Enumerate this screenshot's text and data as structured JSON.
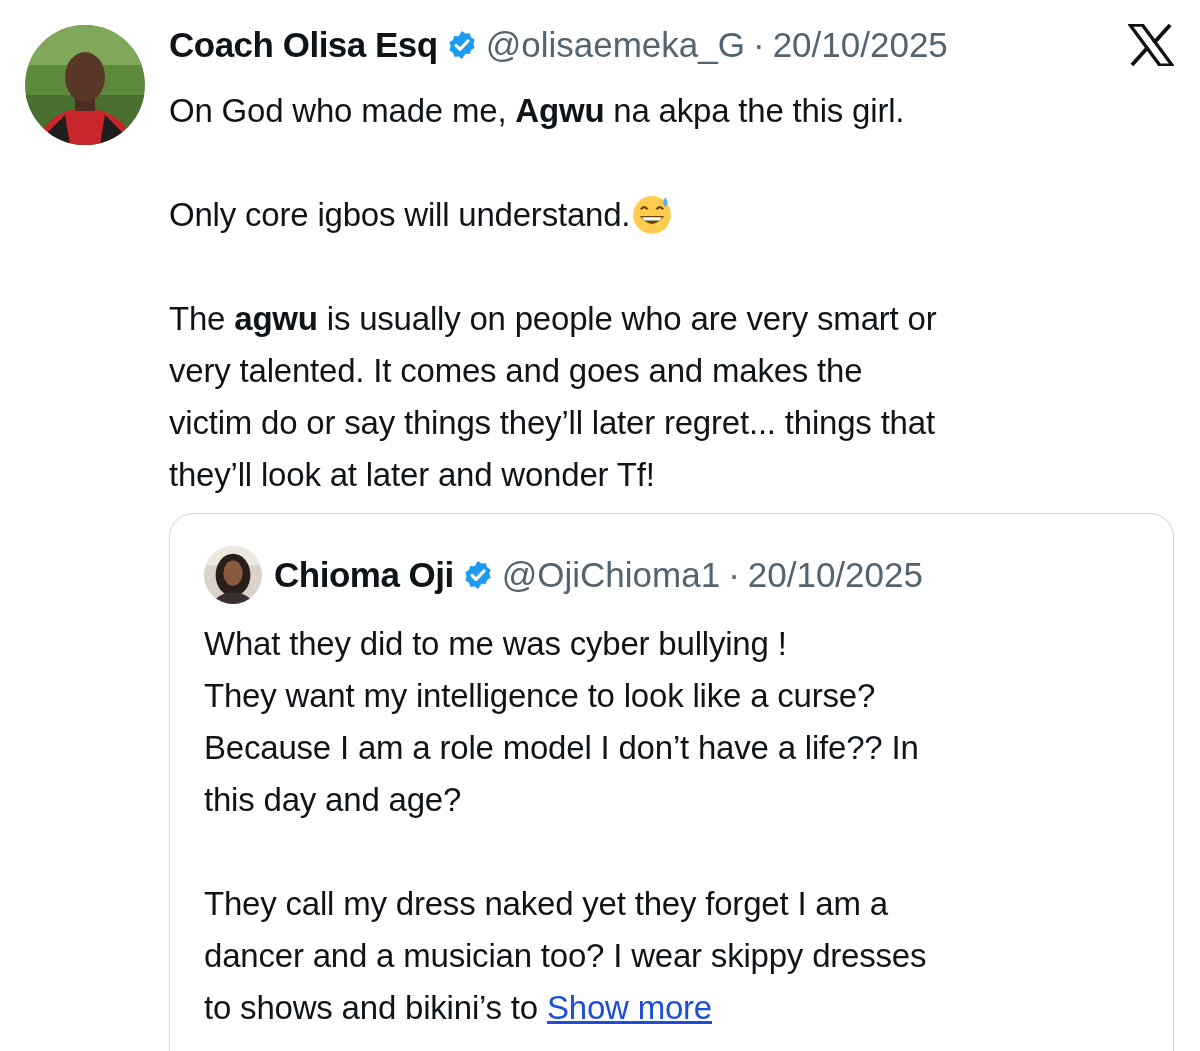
{
  "post": {
    "author": {
      "name": "Coach Olisa Esq",
      "verified": true,
      "handle": "@olisaemeka_G",
      "separator": "·",
      "date": "20/10/2025"
    },
    "paragraphs": [
      {
        "text": "On God who made me, **Agwu** na akpa the this girl.",
        "emoji": false
      },
      {
        "text": "Only core igbos will understand.",
        "emoji": true
      },
      {
        "text": "The **agwu** is usually on people who are very  smart or\nvery talented. It comes and goes and makes the\nvictim do or say things they’ll later regret... things that\nthey’ll look at later and wonder Tf!",
        "emoji": false
      }
    ],
    "quote": {
      "author": {
        "name": "Chioma Oji",
        "verified": true,
        "handle": "@OjiChioma1",
        "separator": "·",
        "date": "20/10/2025"
      },
      "paragraphs": [
        "What they did to me was cyber bullying !\nThey want my intelligence to look like a curse?\nBecause I am a role model I don’t have a life?? In\nthis day and age?",
        "They call my dress naked yet they forget I am a\ndancer and a musician too? I wear skippy dresses\nto shows and bikini’s to"
      ],
      "more_link": "Show more"
    }
  }
}
